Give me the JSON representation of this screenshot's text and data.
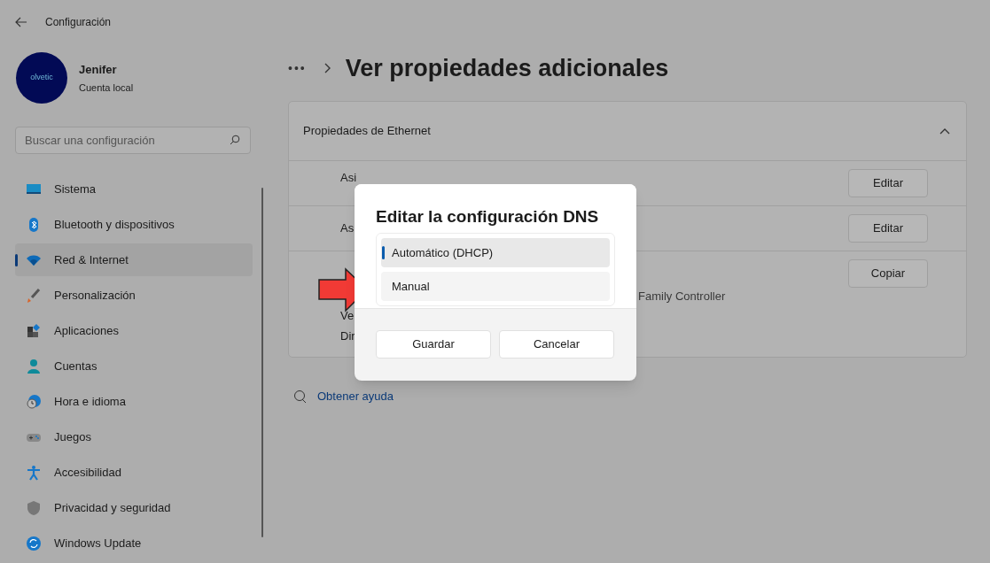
{
  "window": {
    "title": "Configuración"
  },
  "account": {
    "avatar_text": "olvetic",
    "name": "Jenifer",
    "type": "Cuenta local"
  },
  "search": {
    "placeholder": "Buscar una configuración"
  },
  "sidebar": {
    "items": [
      {
        "label": "Sistema",
        "selected": false
      },
      {
        "label": "Bluetooth y dispositivos",
        "selected": false
      },
      {
        "label": "Red & Internet",
        "selected": true
      },
      {
        "label": "Personalización",
        "selected": false
      },
      {
        "label": "Aplicaciones",
        "selected": false
      },
      {
        "label": "Cuentas",
        "selected": false
      },
      {
        "label": "Hora e idioma",
        "selected": false
      },
      {
        "label": "Juegos",
        "selected": false
      },
      {
        "label": "Accesibilidad",
        "selected": false
      },
      {
        "label": "Privacidad y seguridad",
        "selected": false
      },
      {
        "label": "Windows Update",
        "selected": false
      }
    ]
  },
  "breadcrumb": {
    "ellipsis": "•••",
    "title": "Ver propiedades adicionales"
  },
  "card": {
    "title": "Propiedades de Ethernet",
    "expanded": true,
    "rows": [
      {
        "lines": [
          {
            "label": "Asi"
          }
        ],
        "button": "Editar"
      },
      {
        "lines": [
          {
            "label": "As"
          }
        ],
        "button": "Editar"
      },
      {
        "lines": [
          {
            "value": "Family Controller"
          },
          {
            "label": "Ve"
          },
          {
            "label": "Dir"
          }
        ],
        "button": "Copiar"
      }
    ]
  },
  "help_link": "Obtener ayuda",
  "dialog": {
    "title": "Editar la configuración DNS",
    "options": [
      {
        "label": "Automático (DHCP)",
        "selected": true
      },
      {
        "label": "Manual",
        "selected": false
      }
    ],
    "buttons": [
      "Guardar",
      "Cancelar"
    ]
  }
}
